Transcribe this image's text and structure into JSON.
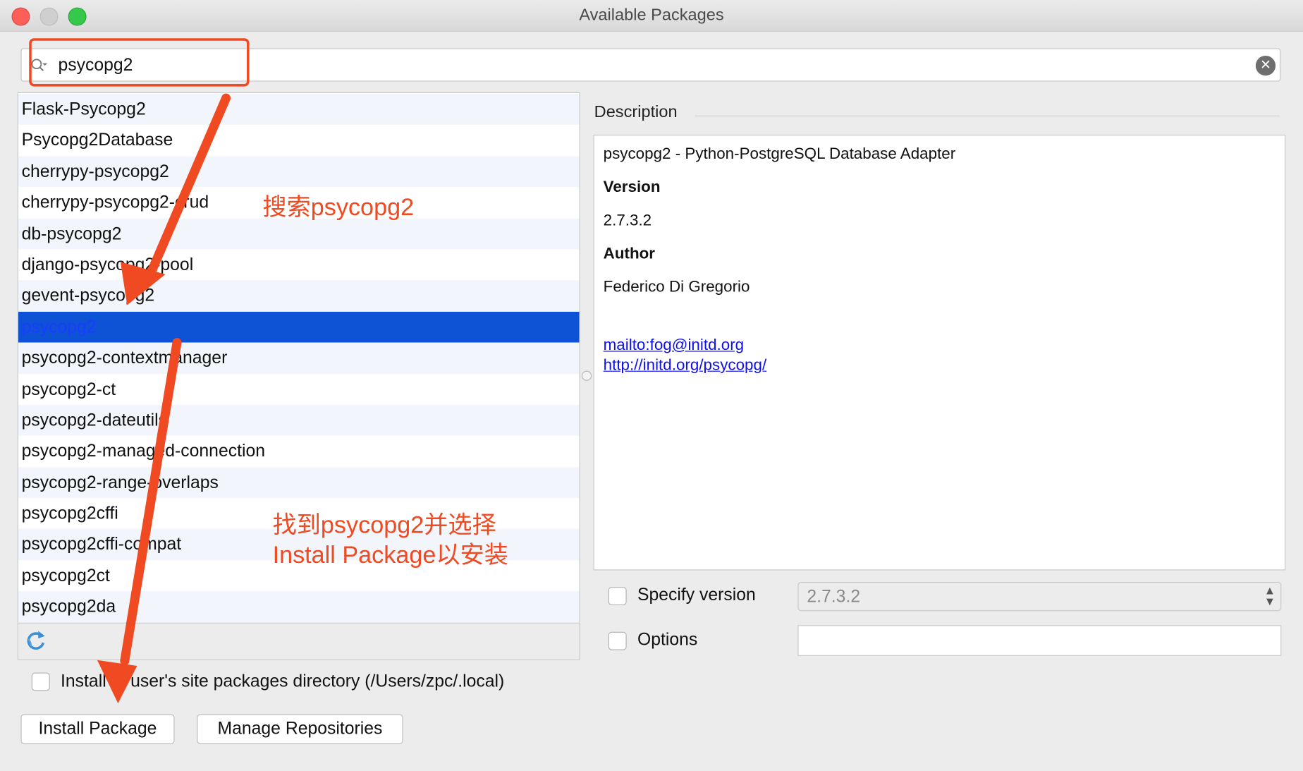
{
  "window": {
    "title": "Available Packages"
  },
  "search": {
    "value": "psycopg2"
  },
  "packages": [
    "Flask-Psycopg2",
    "Psycopg2Database",
    "cherrypy-psycopg2",
    "cherrypy-psycopg2-crud",
    "db-psycopg2",
    "django-psycopg2-pool",
    "gevent-psycopg2",
    "psycopg2",
    "psycopg2-contextmanager",
    "psycopg2-ct",
    "psycopg2-dateutils",
    "psycopg2-managed-connection",
    "psycopg2-range-overlaps",
    "psycopg2cffi",
    "psycopg2cffi-compat",
    "psycopg2ct",
    "psycopg2da"
  ],
  "selected_package": "psycopg2",
  "description": {
    "header": "Description",
    "summary": "psycopg2 - Python-PostgreSQL Database Adapter",
    "version_label": "Version",
    "version": "2.7.3.2",
    "author_label": "Author",
    "author": "Federico Di Gregorio",
    "email_link": "mailto:fog@initd.org",
    "homepage_link": "http://initd.org/psycopg/"
  },
  "options": {
    "specify_version_label": "Specify version",
    "specify_version_checked": false,
    "version_value": "2.7.3.2",
    "options_label": "Options",
    "options_checked": false,
    "options_value": "",
    "user_site_label": "Install to user's site packages directory (/Users/zpc/.local)",
    "user_site_checked": false
  },
  "buttons": {
    "install": "Install Package",
    "manage": "Manage Repositories"
  },
  "annotations": {
    "search_note": "搜索psycopg2",
    "select_note_line1": "找到psycopg2并选择",
    "select_note_line2": "Install Package以安装"
  },
  "colors": {
    "selection": "#0e52d6",
    "annotation": "#f04a22",
    "link": "#1010ee"
  }
}
